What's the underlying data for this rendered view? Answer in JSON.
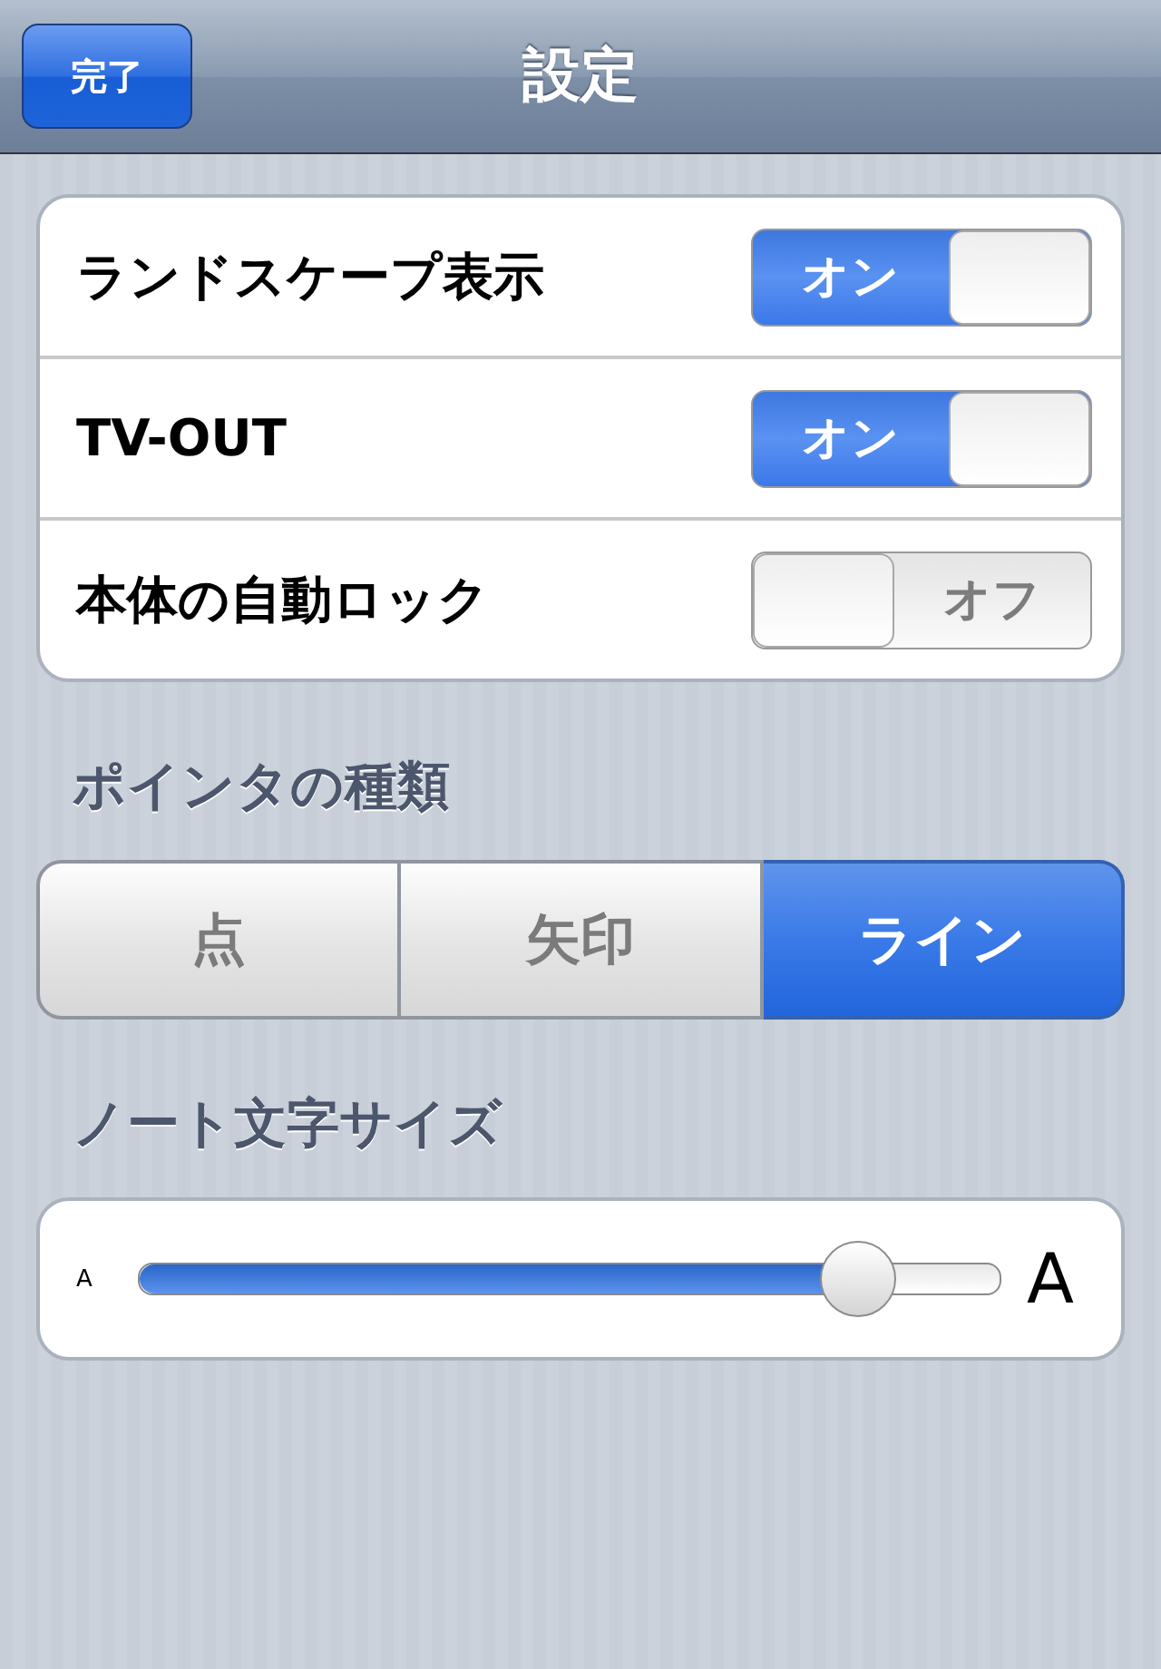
{
  "nav": {
    "done_button": "完了",
    "title": "設定"
  },
  "settings": [
    {
      "label": "ランドスケープ表示",
      "on": true,
      "switch_text": "オン"
    },
    {
      "label": "TV-OUT",
      "on": true,
      "switch_text": "オン"
    },
    {
      "label": "本体の自動ロック",
      "on": false,
      "switch_text": "オフ"
    }
  ],
  "pointer_section": {
    "header": "ポインタの種類",
    "segments": [
      {
        "label": "点",
        "selected": false
      },
      {
        "label": "矢印",
        "selected": false
      },
      {
        "label": "ライン",
        "selected": true
      }
    ]
  },
  "note_section": {
    "header": "ノート文字サイズ",
    "slider": {
      "level": 0.835,
      "min_label": "A",
      "max_label": "A"
    }
  }
}
